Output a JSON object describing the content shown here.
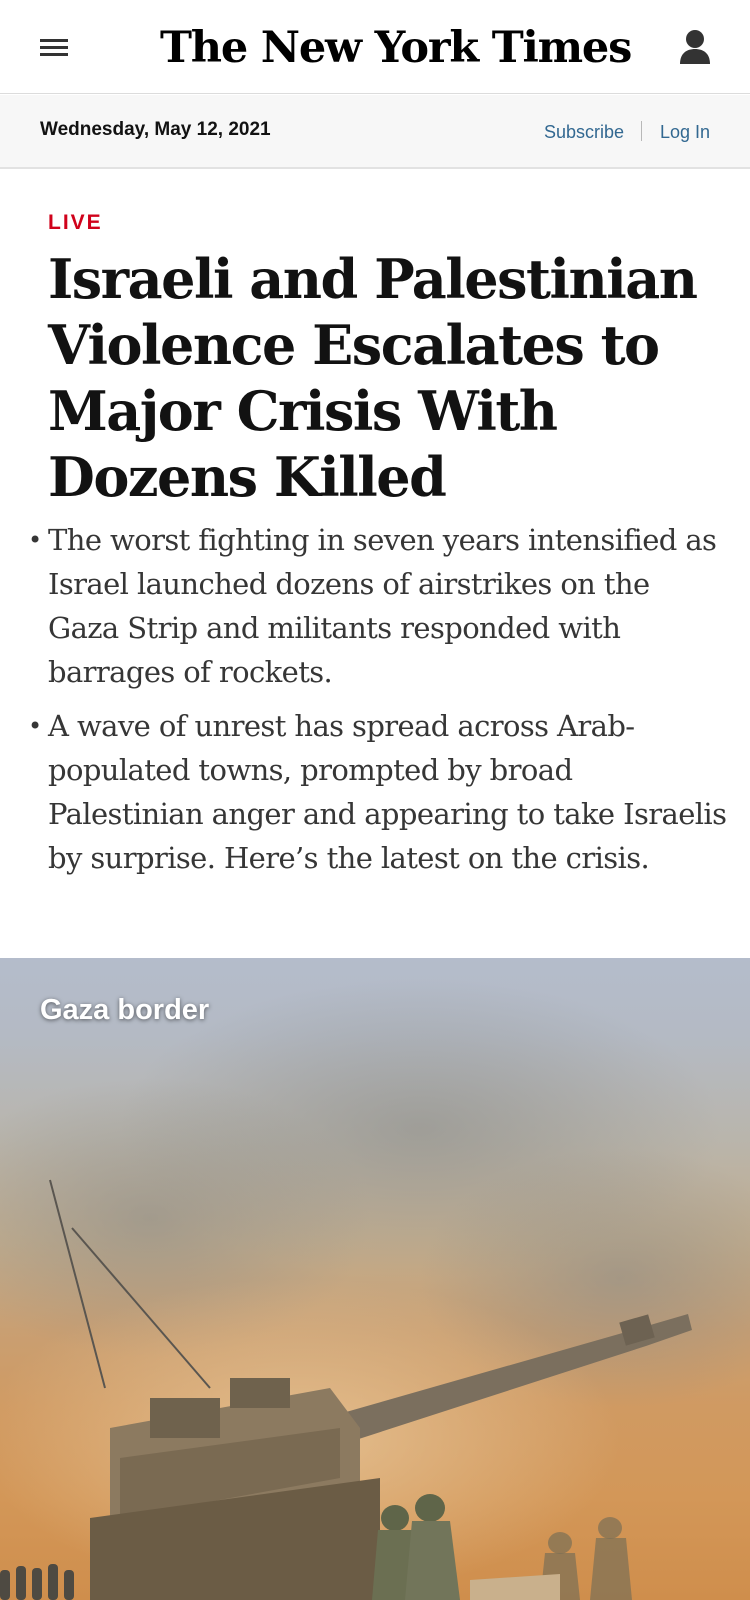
{
  "header": {
    "logo_text": "The New York Times",
    "menu_icon": "hamburger-menu-icon",
    "account_icon": "person-icon"
  },
  "subbar": {
    "date": "Wednesday, May 12, 2021",
    "subscribe_label": "Subscribe",
    "login_label": "Log In"
  },
  "article": {
    "label": "LIVE",
    "headline": "Israeli and Palestinian Violence Escalates to Major Crisis With Dozens Killed",
    "summary": [
      "The worst fighting in seven years intensified as Israel launched dozens of airstrikes on the Gaza Strip and militants responded with barrages of rockets.",
      "A wave of unrest has spread across Arab-populated towns, prompted by broad Palestinian anger and appearing to take Israelis by surprise. Here’s the latest on the crisis."
    ]
  },
  "hero": {
    "caption": "Gaza border"
  },
  "colors": {
    "live_red": "#d0021b",
    "link_blue": "#326891",
    "text": "#121212"
  }
}
